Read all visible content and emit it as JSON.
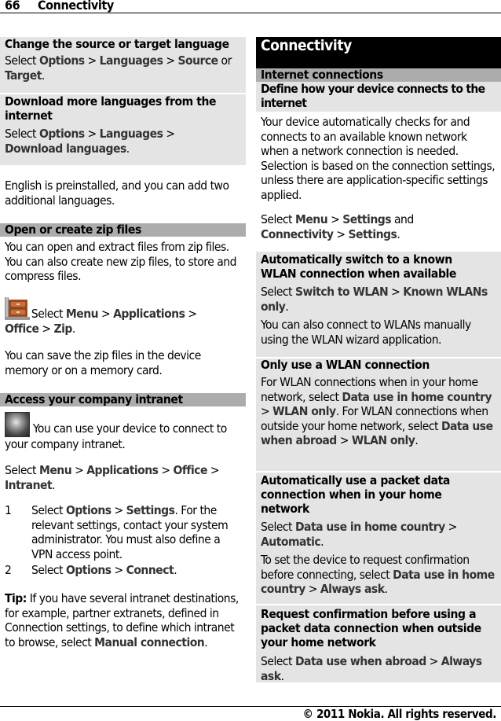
{
  "header": {
    "page_number": "66",
    "section": "Connectivity"
  },
  "footer": {
    "copyright": "© 2011 Nokia. All rights reserved."
  },
  "left": {
    "change_lang": {
      "title": "Change the source or target language",
      "t1": "Select ",
      "o1": "Options",
      "t2": "  > ",
      "o2": "Languages",
      "t3": "  > ",
      "o3": "Source",
      "t4": " or ",
      "o4": "Target",
      "t5": "."
    },
    "download_lang": {
      "title": "Download more languages from the internet",
      "t1": "Select ",
      "o1": "Options",
      "t2": "  > ",
      "o2": "Languages",
      "t3": "  > ",
      "o3": "Download languages",
      "t4": "."
    },
    "english_note": "English is preinstalled, and you can add two additional languages.",
    "zip": {
      "title": "Open or create zip files",
      "intro": "You can open and extract files from zip files. You can also create new zip files, to store and compress files.",
      "icon": "zip-archive-icon",
      "t1": " Select ",
      "o1": "Menu",
      "t2": "  > ",
      "o2": "Applications",
      "t3": "  > ",
      "o3": "Office",
      "t4": "  > ",
      "o4": "Zip",
      "t5": ".",
      "save_note": "You can save the zip files in the device memory or on a memory card."
    },
    "intranet": {
      "title": "Access your company intranet",
      "icon": "intranet-globe-icon",
      "intro": " You can use your device to connect to your company intranet.",
      "t1": "Select ",
      "o1": "Menu",
      "t2": "  > ",
      "o2": "Applications",
      "t3": "  > ",
      "o3": "Office",
      "t4": "  > ",
      "o4": "Intranet",
      "t5": ".",
      "steps": [
        {
          "num": "1",
          "t1": "Select ",
          "o1": "Options",
          "t2": "  > ",
          "o2": "Settings",
          "t3": ". For the relevant settings, contact your system administrator. You must also define a VPN access point."
        },
        {
          "num": "2",
          "t1": "Select ",
          "o1": "Options",
          "t2": "  > ",
          "o2": "Connect",
          "t3": "."
        }
      ],
      "tip_label": "Tip:",
      "tip_text": " If you have several intranet destinations, for example, partner extranets, defined in Connection settings, to define which intranet to browse, select ",
      "tip_option": "Manual connection",
      "tip_end": "."
    }
  },
  "right": {
    "chapter_title": "Connectivity",
    "subchapter": "Internet connections",
    "define": {
      "title": "Define how your device connects to the internet",
      "body": "Your device automatically checks for and connects to an available known network when a network connection is needed. Selection is based on the connection settings, unless there are application-specific settings applied.",
      "t1": "Select ",
      "o1": "Menu",
      "t2": "  > ",
      "o2": "Settings",
      "t3": " and ",
      "o3": "Connectivity",
      "t4": "  > ",
      "o4": "Settings",
      "t5": "."
    },
    "auto_wlan": {
      "title": "Automatically switch to a known WLAN connection when available",
      "t1": "Select ",
      "o1": "Switch to WLAN",
      "t2": "  > ",
      "o2": "Known WLANs only",
      "t3": ".",
      "note": "You can also connect to WLANs manually using the WLAN wizard application."
    },
    "only_wlan": {
      "title": "Only use a WLAN connection",
      "t1": "For WLAN connections when in your home network, select ",
      "o1": "Data use in home country",
      "t2": "  > ",
      "o2": "WLAN only",
      "t3": ". For WLAN connections when outside your home network, select ",
      "o3": "Data use when abroad",
      "t4": "  > ",
      "o4": "WLAN only",
      "t5": "."
    },
    "auto_packet": {
      "title": "Automatically use a packet data connection when in your home network",
      "t1": "Select ",
      "o1": "Data use in home country",
      "t2": "  > ",
      "o2": "Automatic",
      "t3": ".",
      "c1": "To set the device to request confirmation before connecting, select ",
      "co1": "Data use in home country",
      "c2": "  > ",
      "co2": "Always ask",
      "c3": "."
    },
    "request_confirm": {
      "title": "Request confirmation before using a packet data connection when outside your home network",
      "t1": "Select ",
      "o1": "Data use when abroad",
      "t2": "  > ",
      "o2": "Always ask",
      "t3": "."
    }
  }
}
